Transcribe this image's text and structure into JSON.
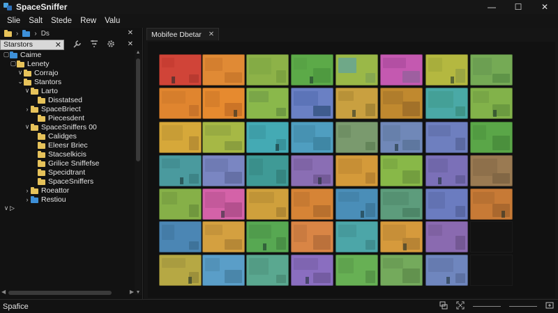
{
  "window": {
    "title": "SpaceSniffer",
    "icon": "app-icon",
    "controls": {
      "minimize": "—",
      "maximize": "☐",
      "close": "✕"
    }
  },
  "menu": [
    "Slie",
    "Salt",
    "Stede",
    "Rew",
    "Valu"
  ],
  "left_panel": {
    "toolbar_label": "Ds",
    "search": {
      "value": "Starstors",
      "clear": "✕"
    },
    "close_glyph": "✕",
    "tree": [
      {
        "label": "Caime",
        "indent": 1,
        "icon": "blue-folder-icon",
        "expander": "▢"
      },
      {
        "label": "Lenety",
        "indent": 2,
        "icon": "folder-icon",
        "expander": "▢"
      },
      {
        "label": "Corrajo",
        "indent": 3,
        "icon": "folder-icon",
        "expander": "∨"
      },
      {
        "label": "Stantors",
        "indent": 3,
        "icon": "folder-icon",
        "expander": "⌄"
      },
      {
        "label": "Larto",
        "indent": 4,
        "icon": "folder-icon",
        "expander": "∨"
      },
      {
        "label": "Disstatsed",
        "indent": 5,
        "icon": "folder-icon",
        "expander": ""
      },
      {
        "label": "SpaceBriect",
        "indent": 4,
        "icon": "folder-icon",
        "expander": "›"
      },
      {
        "label": "Piecesdent",
        "indent": 5,
        "icon": "folder-icon",
        "expander": ""
      },
      {
        "label": "SpaceSniffers 00",
        "indent": 4,
        "icon": "folder-icon",
        "expander": "∨"
      },
      {
        "label": "Calidges",
        "indent": 5,
        "icon": "folder-icon",
        "expander": ""
      },
      {
        "label": "Eleesr Briec",
        "indent": 5,
        "icon": "folder-icon",
        "expander": ""
      },
      {
        "label": "Stacselkicis",
        "indent": 5,
        "icon": "folder-icon",
        "expander": ""
      },
      {
        "label": "Grilice Sniffefse",
        "indent": 5,
        "icon": "folder-icon",
        "expander": ""
      },
      {
        "label": "Specidtrant",
        "indent": 5,
        "icon": "folder-icon",
        "expander": ""
      },
      {
        "label": "SpaceSniffers",
        "indent": 5,
        "icon": "folder-icon",
        "expander": ""
      },
      {
        "label": "Roeattor",
        "indent": 4,
        "icon": "folder-icon",
        "expander": "›"
      },
      {
        "label": "Restiou",
        "indent": 4,
        "icon": "blue-folder-icon",
        "expander": "›"
      },
      {
        "label": "",
        "indent": 1,
        "icon": "play-icon",
        "expander": "∨"
      }
    ]
  },
  "main": {
    "tab": {
      "label": "Mobifee Dbetar",
      "close": "✕"
    },
    "tiles": [
      {
        "base": "#d04438",
        "a": "#c73d32",
        "b": "#b83a30"
      },
      {
        "base": "#e08a35",
        "a": "#d47f2f",
        "b": "#cc7a2c"
      },
      {
        "base": "#8db248",
        "a": "#84ab45",
        "b": "#7ca240"
      },
      {
        "base": "#5caa48",
        "a": "#58a345",
        "b": "#4f9a40"
      },
      {
        "base": "#9ab848",
        "a": "#6fa888",
        "b": "#86a850"
      },
      {
        "base": "#c459b0",
        "a": "#b34fa3",
        "b": "#9e5fa0"
      },
      {
        "base": "#b4b840",
        "a": "#a8ae3c",
        "b": "#9ba542"
      },
      {
        "base": "#75aa55",
        "a": "#6c9f52",
        "b": "#5f9448"
      },
      {
        "base": "#e0852f",
        "a": "#d67e2c",
        "b": "#c9742a"
      },
      {
        "base": "#e68a2f",
        "a": "#d77f2b",
        "b": "#cb7427"
      },
      {
        "base": "#8ab84b",
        "a": "#7aa648",
        "b": "#6f9a42"
      },
      {
        "base": "#6a80c4",
        "a": "#5c74b8",
        "b": "#3f5c8e"
      },
      {
        "base": "#c9a040",
        "a": "#b89238",
        "b": "#a78635"
      },
      {
        "base": "#c0892f",
        "a": "#b07d2c",
        "b": "#a27129"
      },
      {
        "base": "#4aa9a6",
        "a": "#44a097",
        "b": "#3e9488"
      },
      {
        "base": "#82b24a",
        "a": "#78a646",
        "b": "#6b9a40"
      },
      {
        "base": "#d6a83a",
        "a": "#c89d36",
        "b": "#b98f33"
      },
      {
        "base": "#a6b845",
        "a": "#98ab42",
        "b": "#8b9f3e"
      },
      {
        "base": "#44aab4",
        "a": "#3e9ea8",
        "b": "#38929b"
      },
      {
        "base": "#4f9ec0",
        "a": "#4792b2",
        "b": "#3f87a5"
      },
      {
        "base": "#7a9a6e",
        "a": "#6f8f64",
        "b": "#64855a"
      },
      {
        "base": "#7088b8",
        "a": "#6780ab",
        "b": "#5e779f"
      },
      {
        "base": "#6e7fbf",
        "a": "#6474b0",
        "b": "#5b6aa2"
      },
      {
        "base": "#5aa648",
        "a": "#529b42",
        "b": "#4b903d"
      },
      {
        "base": "#4a9a9e",
        "a": "#438f93",
        "b": "#3d8487"
      },
      {
        "base": "#7a86c2",
        "a": "#6f7bb4",
        "b": "#6570a6"
      },
      {
        "base": "#3f9a96",
        "a": "#3a8f8b",
        "b": "#358580"
      },
      {
        "base": "#8a6eb4",
        "a": "#7f64a6",
        "b": "#745a98"
      },
      {
        "base": "#d49a3a",
        "a": "#c78f35",
        "b": "#b98431"
      },
      {
        "base": "#88b848",
        "a": "#7dab43",
        "b": "#739e3f"
      },
      {
        "base": "#7b70b8",
        "a": "#7067aa",
        "b": "#655e9c"
      },
      {
        "base": "#9a7a52",
        "a": "#8e704b",
        "b": "#826745"
      },
      {
        "base": "#86b048",
        "a": "#7ba343",
        "b": "#70973e"
      },
      {
        "base": "#d462a8",
        "a": "#c4599b",
        "b": "#b4508e"
      },
      {
        "base": "#cfa03c",
        "a": "#c09437",
        "b": "#b18833"
      },
      {
        "base": "#d68436",
        "a": "#c77a32",
        "b": "#b8702e"
      },
      {
        "base": "#4a8eb8",
        "a": "#4484ab",
        "b": "#3e7a9e"
      },
      {
        "base": "#5d9c7c",
        "a": "#559172",
        "b": "#4d8668"
      },
      {
        "base": "#6b7cc0",
        "a": "#6272b2",
        "b": "#5968a4"
      },
      {
        "base": "#c77a36",
        "a": "#b87132",
        "b": "#aa682e"
      },
      {
        "base": "#4b86b4",
        "a": "#447ca7",
        "b": "#3e739a"
      },
      {
        "base": "#d4a040",
        "a": "#c5943b",
        "b": "#b68836"
      },
      {
        "base": "#57a852",
        "a": "#509c4c",
        "b": "#499046"
      },
      {
        "base": "#d98545",
        "a": "#ca7b40",
        "b": "#bb713b"
      },
      {
        "base": "#4ca6a8",
        "a": "#469a9c",
        "b": "#408e90"
      },
      {
        "base": "#d69a3c",
        "a": "#c78f38",
        "b": "#b88434"
      },
      {
        "base": "#8a6ab0",
        "a": "#7f61a2",
        "b": "#745894"
      },
      null,
      {
        "base": "#b6a844",
        "a": "#a99c40",
        "b": "#9c903b"
      },
      {
        "base": "#5a9ec8",
        "a": "#5292b9",
        "b": "#4a86aa"
      },
      {
        "base": "#5aa890",
        "a": "#539c85",
        "b": "#4c907a"
      },
      {
        "base": "#8a6ec0",
        "a": "#7f65b1",
        "b": "#745ca2"
      },
      {
        "base": "#67b054",
        "a": "#5fa34e",
        "b": "#579648"
      },
      {
        "base": "#74aa5c",
        "a": "#6b9e55",
        "b": "#62924e"
      },
      {
        "base": "#6f86be",
        "a": "#667bb0",
        "b": "#5d71a2"
      },
      null
    ]
  },
  "status": {
    "text": "Spafice",
    "icons": [
      "copy-icon",
      "fullscreen-icon",
      "zoom-slider",
      "resize-icon"
    ]
  }
}
